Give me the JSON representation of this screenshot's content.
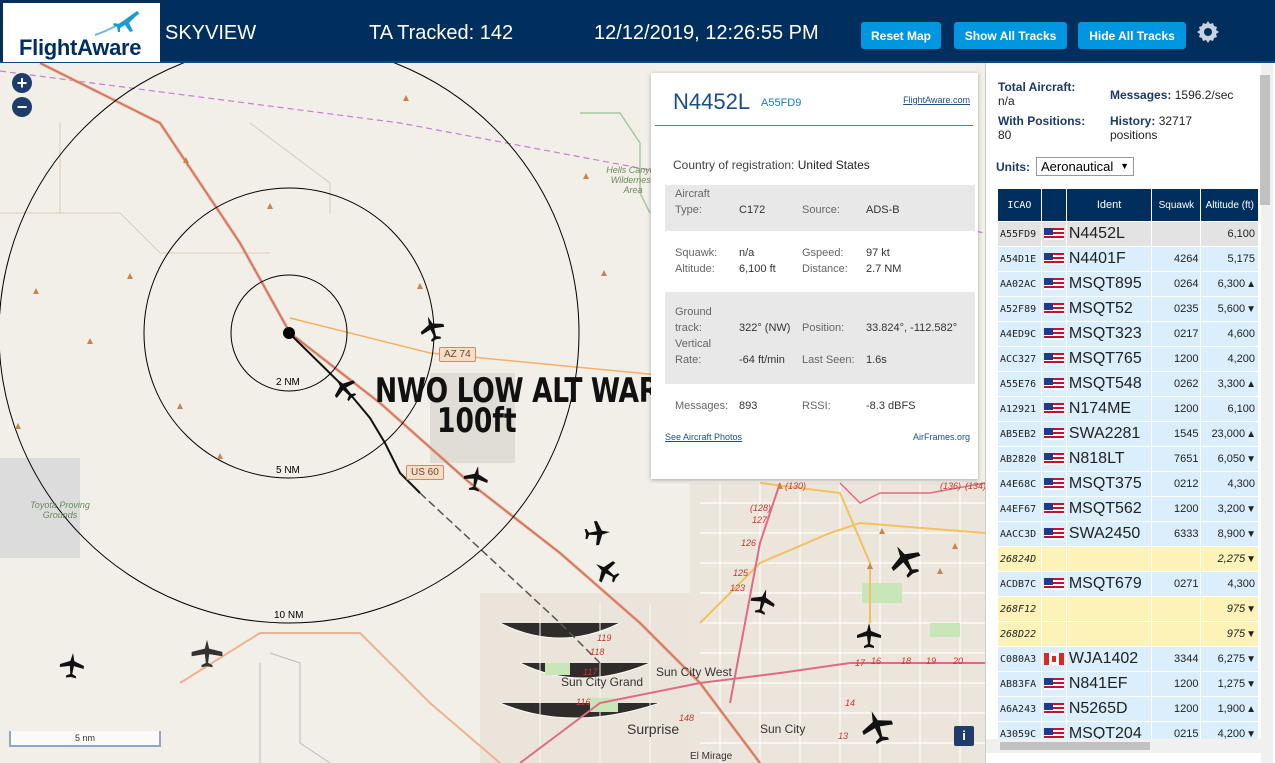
{
  "header": {
    "logo": "FlightAware",
    "app_name": "SKYVIEW",
    "tracked": "TA Tracked: 142",
    "datetime": "12/12/2019, 12:26:55 PM",
    "buttons": {
      "reset": "Reset Map",
      "show": "Show All Tracks",
      "hide": "Hide All Tracks"
    },
    "settings_icon": "gear-icon"
  },
  "map": {
    "zoom_in": "+",
    "zoom_out": "−",
    "ring_labels": [
      "2 NM",
      "5 NM",
      "10 NM"
    ],
    "road_labels": [
      "AZ 74",
      "US 60"
    ],
    "towns": [
      "Sun City West",
      "Sun City Grand",
      "Sun City",
      "Surprise",
      "El Mirage"
    ],
    "areas": [
      "Hells Canyon Wilderness Area",
      "Toyota Proving Grounds"
    ],
    "route_numbers": [
      "(130)",
      "(128)",
      "127",
      "126",
      "125",
      "123",
      "119",
      "118",
      "117",
      "116",
      "148",
      "17",
      "16",
      "18",
      "19",
      "20",
      "14",
      "13",
      "(136)",
      "(134)"
    ],
    "overlay_title": "NWO LOW ALT WARRIOR",
    "overlay_subtitle": "100ft",
    "scale": "5 nm",
    "info": "i"
  },
  "popup": {
    "ident": "N4452L",
    "icao": "A55FD9",
    "link": "FlightAware.com",
    "country_label": "Country of registration:",
    "country": "United States",
    "aircraft_type_label": "Aircraft Type:",
    "aircraft_label_a": "Aircraft",
    "aircraft_label_b": "Type:",
    "aircraft_type": "C172",
    "source_label": "Source:",
    "source": "ADS-B",
    "squawk_label": "Squawk:",
    "squawk": "n/a",
    "gspeed_label": "Gspeed:",
    "gspeed": "97 kt",
    "altitude_label": "Altitude:",
    "altitude": "6,100 ft",
    "distance_label": "Distance:",
    "distance": "2.7 NM",
    "ground_label_a": "Ground",
    "ground_label_b": "track:",
    "ground_track": "322° (NW)",
    "position_label": "Position:",
    "position": "33.824°, -112.582°",
    "vrate_label_a": "Vertical",
    "vrate_label_b": "Rate:",
    "vertical_rate": "-64 ft/min",
    "last_seen_label": "Last Seen:",
    "last_seen": "1.6s",
    "messages_label": "Messages:",
    "messages": "893",
    "rssi_label": "RSSI:",
    "rssi": "-8.3 dBFS",
    "photos_link": "See Aircraft Photos",
    "airframes_link": "AirFrames.org"
  },
  "sidebar": {
    "total_label": "Total Aircraft:",
    "total": "n/a",
    "messages_label": "Messages:",
    "messages": "1596.2/sec",
    "positions_label": "With Positions:",
    "positions": "80",
    "history_label": "History:",
    "history": "32717",
    "history_unit": "positions",
    "units_label": "Units:",
    "units_value": "Aeronautical",
    "columns": [
      "ICAO",
      "",
      "Ident",
      "Squawk",
      "Altitude (ft)"
    ],
    "rows": [
      {
        "icao": "A55FD9",
        "flag": "us",
        "ident": "N4452L",
        "squawk": "",
        "alt": "6,100",
        "trend": "",
        "style": "selected"
      },
      {
        "icao": "A54D1E",
        "flag": "us",
        "ident": "N4401F",
        "squawk": "4264",
        "alt": "5,175",
        "trend": "",
        "style": "normal"
      },
      {
        "icao": "AA02AC",
        "flag": "us",
        "ident": "MSQT895",
        "squawk": "0264",
        "alt": "6,300",
        "trend": "▲",
        "style": "normal"
      },
      {
        "icao": "A52F89",
        "flag": "us",
        "ident": "MSQT52",
        "squawk": "0235",
        "alt": "5,600",
        "trend": "▼",
        "style": "normal"
      },
      {
        "icao": "A4ED9C",
        "flag": "us",
        "ident": "MSQT323",
        "squawk": "0217",
        "alt": "4,600",
        "trend": "",
        "style": "normal"
      },
      {
        "icao": "ACC327",
        "flag": "us",
        "ident": "MSQT765",
        "squawk": "1200",
        "alt": "4,200",
        "trend": "",
        "style": "normal"
      },
      {
        "icao": "A55E76",
        "flag": "us",
        "ident": "MSQT548",
        "squawk": "0262",
        "alt": "3,300",
        "trend": "▲",
        "style": "normal"
      },
      {
        "icao": "A12921",
        "flag": "us",
        "ident": "N174ME",
        "squawk": "1200",
        "alt": "6,100",
        "trend": "",
        "style": "normal"
      },
      {
        "icao": "AB5EB2",
        "flag": "us",
        "ident": "SWA2281",
        "squawk": "1545",
        "alt": "23,000",
        "trend": "▲",
        "style": "normal"
      },
      {
        "icao": "AB2820",
        "flag": "us",
        "ident": "N818LT",
        "squawk": "7651",
        "alt": "6,050",
        "trend": "▼",
        "style": "normal"
      },
      {
        "icao": "A4E68C",
        "flag": "us",
        "ident": "MSQT375",
        "squawk": "0212",
        "alt": "4,300",
        "trend": "",
        "style": "normal"
      },
      {
        "icao": "A4EF67",
        "flag": "us",
        "ident": "MSQT562",
        "squawk": "1200",
        "alt": "3,200",
        "trend": "▼",
        "style": "normal"
      },
      {
        "icao": "AACC3D",
        "flag": "us",
        "ident": "SWA2450",
        "squawk": "6333",
        "alt": "8,900",
        "trend": "▼",
        "style": "normal"
      },
      {
        "icao": "26824D",
        "flag": "",
        "ident": "",
        "squawk": "",
        "alt": "2,275",
        "trend": "▼",
        "style": "yellow"
      },
      {
        "icao": "ACDB7C",
        "flag": "us",
        "ident": "MSQT679",
        "squawk": "0271",
        "alt": "4,300",
        "trend": "",
        "style": "normal"
      },
      {
        "icao": "268F12",
        "flag": "",
        "ident": "",
        "squawk": "",
        "alt": "975",
        "trend": "▼",
        "style": "yellow"
      },
      {
        "icao": "268D22",
        "flag": "",
        "ident": "",
        "squawk": "",
        "alt": "975",
        "trend": "▼",
        "style": "yellow"
      },
      {
        "icao": "C080A3",
        "flag": "ca",
        "ident": "WJA1402",
        "squawk": "3344",
        "alt": "6,275",
        "trend": "▼",
        "style": "normal"
      },
      {
        "icao": "AB83FA",
        "flag": "us",
        "ident": "N841EF",
        "squawk": "1200",
        "alt": "1,275",
        "trend": "▼",
        "style": "normal"
      },
      {
        "icao": "A6A243",
        "flag": "us",
        "ident": "N5265D",
        "squawk": "1200",
        "alt": "1,900",
        "trend": "▲",
        "style": "normal"
      },
      {
        "icao": "A3059C",
        "flag": "us",
        "ident": "MSQT204",
        "squawk": "0215",
        "alt": "4,200",
        "trend": "▼",
        "style": "normal"
      }
    ]
  },
  "colors": {
    "header_bg": "#002f5d",
    "button": "#0096e0",
    "row_blue": "#dbeefc",
    "row_yellow": "#fdf3b8",
    "route": "#e8a060",
    "track": "#f5a340"
  }
}
